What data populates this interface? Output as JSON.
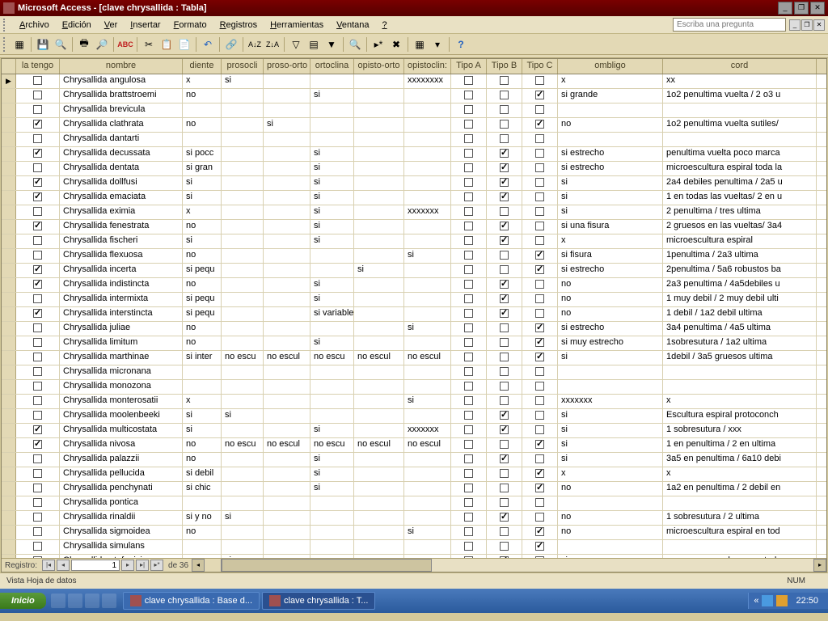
{
  "title": "Microsoft Access - [clave chrysallida : Tabla]",
  "menu": [
    "Archivo",
    "Edición",
    "Ver",
    "Insertar",
    "Formato",
    "Registros",
    "Herramientas",
    "Ventana",
    "?"
  ],
  "questionPlaceholder": "Escriba una pregunta",
  "columns": [
    "la tengo",
    "nombre",
    "diente",
    "prosocli",
    "proso-orto",
    "ortoclina",
    "opisto-orto",
    "opistoclin:",
    "Tipo A",
    "Tipo B",
    "Tipo C",
    "ombligo",
    "cord"
  ],
  "rows": [
    {
      "t": false,
      "n": "Chrysallida angulosa",
      "d": "x",
      "pc": "si",
      "po": "",
      "oc": "",
      "oo": "",
      "op": "xxxxxxxx",
      "a": false,
      "b": false,
      "c": false,
      "om": "x",
      "co": "xx"
    },
    {
      "t": false,
      "n": "Chrysallida brattstroemi",
      "d": "no",
      "pc": "",
      "po": "",
      "oc": "si",
      "oo": "",
      "op": "",
      "a": false,
      "b": false,
      "c": true,
      "om": "si grande",
      "co": "1o2 penultima vuelta / 2 o3 u"
    },
    {
      "t": false,
      "n": "Chrysallida brevicula",
      "d": "",
      "pc": "",
      "po": "",
      "oc": "",
      "oo": "",
      "op": "",
      "a": false,
      "b": false,
      "c": false,
      "om": "",
      "co": ""
    },
    {
      "t": true,
      "n": "Chrysallida clathrata",
      "d": "no",
      "pc": "",
      "po": "si",
      "oc": "",
      "oo": "",
      "op": "",
      "a": false,
      "b": false,
      "c": true,
      "om": "no",
      "co": "1o2 penultima vuelta sutiles/"
    },
    {
      "t": false,
      "n": "Chrysallida dantarti",
      "d": "",
      "pc": "",
      "po": "",
      "oc": "",
      "oo": "",
      "op": "",
      "a": false,
      "b": false,
      "c": false,
      "om": "",
      "co": ""
    },
    {
      "t": true,
      "n": "Chrysallida decussata",
      "d": "si pocc",
      "pc": "",
      "po": "",
      "oc": "si",
      "oo": "",
      "op": "",
      "a": false,
      "b": true,
      "c": false,
      "om": "si estrecho",
      "co": "penultima vuelta poco marca"
    },
    {
      "t": false,
      "n": "Chrysallida dentata",
      "d": "si gran",
      "pc": "",
      "po": "",
      "oc": "si",
      "oo": "",
      "op": "",
      "a": false,
      "b": true,
      "c": false,
      "om": "si estrecho",
      "co": "microescultura espiral toda la"
    },
    {
      "t": true,
      "n": "Chrysallida dollfusi",
      "d": "si",
      "pc": "",
      "po": "",
      "oc": "si",
      "oo": "",
      "op": "",
      "a": false,
      "b": true,
      "c": false,
      "om": "si",
      "co": "2a4 debiles penultima / 2a5 u"
    },
    {
      "t": true,
      "n": "Chrysallida emaciata",
      "d": "si",
      "pc": "",
      "po": "",
      "oc": "si",
      "oo": "",
      "op": "",
      "a": false,
      "b": true,
      "c": false,
      "om": "si",
      "co": "1 en todas las vueltas/ 2 en u"
    },
    {
      "t": false,
      "n": "Chrysallida eximia",
      "d": "x",
      "pc": "",
      "po": "",
      "oc": "si",
      "oo": "",
      "op": "xxxxxxx",
      "a": false,
      "b": false,
      "c": false,
      "om": "si",
      "co": "2 penultima / tres ultima"
    },
    {
      "t": true,
      "n": "Chrysallida fenestrata",
      "d": "no",
      "pc": "",
      "po": "",
      "oc": "si",
      "oo": "",
      "op": "",
      "a": false,
      "b": true,
      "c": false,
      "om": "si una fisura",
      "co": "2 gruesos en las vueltas/ 3a4"
    },
    {
      "t": false,
      "n": "Chrysallida fischeri",
      "d": "si",
      "pc": "",
      "po": "",
      "oc": "si",
      "oo": "",
      "op": "",
      "a": false,
      "b": true,
      "c": false,
      "om": "x",
      "co": "microescultura espiral"
    },
    {
      "t": false,
      "n": "Chrysallida flexuosa",
      "d": "no",
      "pc": "",
      "po": "",
      "oc": "",
      "oo": "",
      "op": "si",
      "a": false,
      "b": false,
      "c": true,
      "om": "si fisura",
      "co": "1penultima / 2a3 ultima"
    },
    {
      "t": true,
      "n": "Chrysallida incerta",
      "d": "si pequ",
      "pc": "",
      "po": "",
      "oc": "",
      "oo": "si",
      "op": "",
      "a": false,
      "b": false,
      "c": true,
      "om": "si estrecho",
      "co": "2penultima / 5a6 robustos ba"
    },
    {
      "t": true,
      "n": "Chrysallida indistincta",
      "d": "no",
      "pc": "",
      "po": "",
      "oc": "si",
      "oo": "",
      "op": "",
      "a": false,
      "b": true,
      "c": false,
      "om": "no",
      "co": "2a3 penultima / 4a5debiles u"
    },
    {
      "t": false,
      "n": "Chrysallida intermixta",
      "d": "si pequ",
      "pc": "",
      "po": "",
      "oc": "si",
      "oo": "",
      "op": "",
      "a": false,
      "b": true,
      "c": false,
      "om": "no",
      "co": "1 muy debil / 2 muy debil ulti"
    },
    {
      "t": true,
      "n": "Chrysallida interstincta",
      "d": "si pequ",
      "pc": "",
      "po": "",
      "oc": "si variable",
      "oo": "",
      "op": "",
      "a": false,
      "b": true,
      "c": false,
      "om": "no",
      "co": "1 debil / 1a2 debil ultima"
    },
    {
      "t": false,
      "n": "Chrysallida juliae",
      "d": "no",
      "pc": "",
      "po": "",
      "oc": "",
      "oo": "",
      "op": "si",
      "a": false,
      "b": false,
      "c": true,
      "om": "si estrecho",
      "co": "3a4 penultima / 4a5 ultima"
    },
    {
      "t": false,
      "n": "Chrysallida limitum",
      "d": "no",
      "pc": "",
      "po": "",
      "oc": "si",
      "oo": "",
      "op": "",
      "a": false,
      "b": false,
      "c": true,
      "om": "si muy estrecho",
      "co": "1sobresutura / 1a2 ultima"
    },
    {
      "t": false,
      "n": "Chrysallida marthinae",
      "d": "si inter",
      "pc": "no escu",
      "po": "no  escul",
      "oc": "no escu",
      "oo": "no escul",
      "op": "no escul",
      "a": false,
      "b": false,
      "c": true,
      "om": "si",
      "co": "1debil / 3a5 gruesos ultima"
    },
    {
      "t": false,
      "n": "Chrysallida micronana",
      "d": "",
      "pc": "",
      "po": "",
      "oc": "",
      "oo": "",
      "op": "",
      "a": false,
      "b": false,
      "c": false,
      "om": "",
      "co": ""
    },
    {
      "t": false,
      "n": "Chrysallida monozona",
      "d": "",
      "pc": "",
      "po": "",
      "oc": "",
      "oo": "",
      "op": "",
      "a": false,
      "b": false,
      "c": false,
      "om": "",
      "co": ""
    },
    {
      "t": false,
      "n": "Chrysallida monterosatii",
      "d": "x",
      "pc": "",
      "po": "",
      "oc": "",
      "oo": "",
      "op": "si",
      "a": false,
      "b": false,
      "c": false,
      "om": "xxxxxxx",
      "co": "x"
    },
    {
      "t": false,
      "n": "Chrysallida moolenbeeki",
      "d": "si",
      "pc": "si",
      "po": "",
      "oc": "",
      "oo": "",
      "op": "",
      "a": false,
      "b": true,
      "c": false,
      "om": "si",
      "co": "Escultura espiral protoconch"
    },
    {
      "t": true,
      "n": "Chrysallida multicostata",
      "d": "si",
      "pc": "",
      "po": "",
      "oc": "si",
      "oo": "",
      "op": "xxxxxxx",
      "a": false,
      "b": true,
      "c": false,
      "om": "si",
      "co": "1 sobresutura / xxx"
    },
    {
      "t": true,
      "n": "Chrysallida nivosa",
      "d": "no",
      "pc": "no escu",
      "po": "no  escul",
      "oc": "no escu",
      "oo": "no escul",
      "op": "no escul",
      "a": false,
      "b": false,
      "c": true,
      "om": "si",
      "co": "1 en penultima / 2 en ultima"
    },
    {
      "t": false,
      "n": "Chrysallida palazzii",
      "d": "no",
      "pc": "",
      "po": "",
      "oc": "si",
      "oo": "",
      "op": "",
      "a": false,
      "b": true,
      "c": false,
      "om": "si",
      "co": "3a5 en penultima / 6a10 debi"
    },
    {
      "t": false,
      "n": "Chrysallida pellucida",
      "d": "si debil",
      "pc": "",
      "po": "",
      "oc": "si",
      "oo": "",
      "op": "",
      "a": false,
      "b": false,
      "c": true,
      "om": "x",
      "co": "x"
    },
    {
      "t": false,
      "n": "Chrysallida penchynati",
      "d": "si chic",
      "pc": "",
      "po": "",
      "oc": "si",
      "oo": "",
      "op": "",
      "a": false,
      "b": false,
      "c": true,
      "om": "no",
      "co": "1a2 en penultima / 2 debil en"
    },
    {
      "t": false,
      "n": "Chrysallida pontica",
      "d": "",
      "pc": "",
      "po": "",
      "oc": "",
      "oo": "",
      "op": "",
      "a": false,
      "b": false,
      "c": false,
      "om": "",
      "co": ""
    },
    {
      "t": false,
      "n": "Chrysallida rinaldii",
      "d": "si y no",
      "pc": "si",
      "po": "",
      "oc": "",
      "oo": "",
      "op": "",
      "a": false,
      "b": true,
      "c": false,
      "om": "no",
      "co": "1 sobresutura / 2 ultima"
    },
    {
      "t": false,
      "n": "Chrysallida sigmoidea",
      "d": "no",
      "pc": "",
      "po": "",
      "oc": "",
      "oo": "",
      "op": "si",
      "a": false,
      "b": false,
      "c": true,
      "om": "no",
      "co": "microescultura espiral en tod"
    },
    {
      "t": false,
      "n": "Chrysallida simulans",
      "d": "",
      "pc": "",
      "po": "",
      "oc": "",
      "oo": "",
      "op": "",
      "a": false,
      "b": false,
      "c": true,
      "om": "",
      "co": ""
    },
    {
      "t": false,
      "n": "Chrysallida stefanisi",
      "d": "no",
      "pc": "si",
      "po": "",
      "oc": "",
      "oo": "",
      "op": "",
      "a": false,
      "b": true,
      "c": false,
      "om": "si",
      "co": "numerosos cordones en toda"
    }
  ],
  "recordNav": {
    "label": "Registro:",
    "current": "1",
    "total": "de  36"
  },
  "statusText": "Vista Hoja de datos",
  "statusNum": "NUM",
  "taskbar": {
    "start": "Inicio",
    "tasks": [
      "clave chrysallida : Base d...",
      "clave chrysallida : T..."
    ],
    "clock": "22:50"
  }
}
